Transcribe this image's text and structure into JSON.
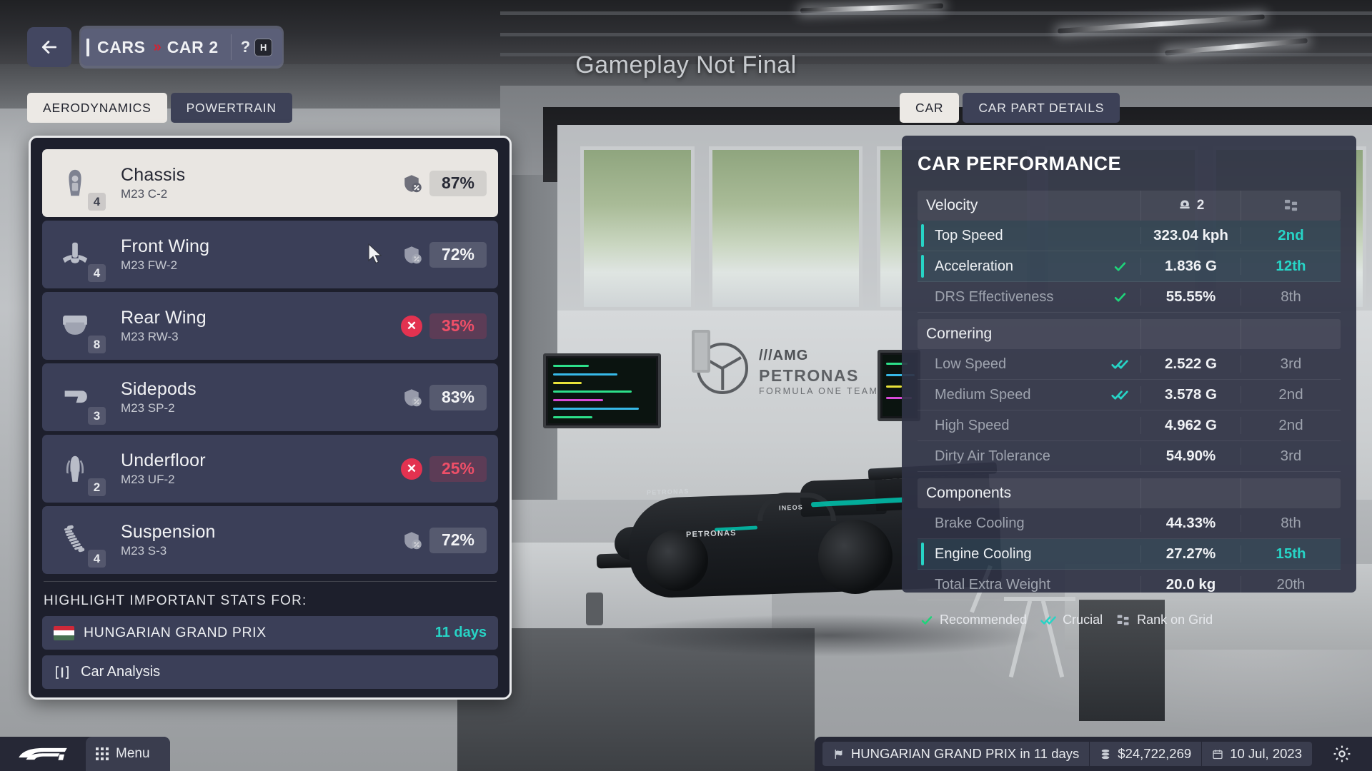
{
  "watermark": "Gameplay Not Final",
  "nav": {
    "back_icon": "arrow-left-icon",
    "breadcrumb_root": "CARS",
    "breadcrumb_sep": "»",
    "breadcrumb_current": "CAR 2",
    "help_glyph": "?",
    "help_key": "H"
  },
  "tabs_left": [
    {
      "label": "AERODYNAMICS",
      "active": true
    },
    {
      "label": "POWERTRAIN",
      "active": false
    }
  ],
  "tabs_right": [
    {
      "label": "CAR",
      "active": true
    },
    {
      "label": "CAR PART DETAILS",
      "active": false
    }
  ],
  "parts": [
    {
      "name": "Chassis",
      "model": "M23 C-2",
      "count": "4",
      "condition": "87%",
      "status": "ok",
      "icon": "chassis-icon",
      "selected": true
    },
    {
      "name": "Front Wing",
      "model": "M23 FW-2",
      "count": "4",
      "condition": "72%",
      "status": "ok",
      "icon": "front-wing-icon",
      "selected": false
    },
    {
      "name": "Rear Wing",
      "model": "M23 RW-3",
      "count": "8",
      "condition": "35%",
      "status": "bad",
      "icon": "rear-wing-icon",
      "selected": false
    },
    {
      "name": "Sidepods",
      "model": "M23 SP-2",
      "count": "3",
      "condition": "83%",
      "status": "ok",
      "icon": "sidepods-icon",
      "selected": false
    },
    {
      "name": "Underfloor",
      "model": "M23 UF-2",
      "count": "2",
      "condition": "25%",
      "status": "bad",
      "icon": "underfloor-icon",
      "selected": false
    },
    {
      "name": "Suspension",
      "model": "M23 S-3",
      "count": "4",
      "condition": "72%",
      "status": "ok",
      "icon": "suspension-icon",
      "selected": false
    }
  ],
  "highlight": {
    "label": "HIGHLIGHT IMPORTANT STATS FOR:",
    "race_name": "HUNGARIAN GRAND PRIX",
    "race_days": "11 days",
    "flag": [
      "#ce2939",
      "#ffffff",
      "#477050"
    ],
    "analysis_label": "Car Analysis"
  },
  "performance": {
    "title": "CAR PERFORMANCE",
    "driver_number": "2",
    "groups": [
      {
        "name": "Velocity",
        "show_header_icons": true,
        "rows": [
          {
            "name": "Top Speed",
            "mark": "",
            "value": "323.04 kph",
            "rank": "2nd",
            "highlight": true,
            "rank_teal": true
          },
          {
            "name": "Acceleration",
            "mark": "check",
            "value": "1.836 G",
            "rank": "12th",
            "highlight": true,
            "rank_teal": true
          },
          {
            "name": "DRS Effectiveness",
            "mark": "check",
            "value": "55.55%",
            "rank": "8th",
            "highlight": false,
            "rank_teal": false
          }
        ]
      },
      {
        "name": "Cornering",
        "show_header_icons": false,
        "rows": [
          {
            "name": "Low Speed",
            "mark": "dblcheck",
            "value": "2.522 G",
            "rank": "3rd",
            "highlight": false,
            "rank_teal": false
          },
          {
            "name": "Medium Speed",
            "mark": "dblcheck",
            "value": "3.578 G",
            "rank": "2nd",
            "highlight": false,
            "rank_teal": false
          },
          {
            "name": "High Speed",
            "mark": "",
            "value": "4.962 G",
            "rank": "2nd",
            "highlight": false,
            "rank_teal": false
          },
          {
            "name": "Dirty Air Tolerance",
            "mark": "",
            "value": "54.90%",
            "rank": "3rd",
            "highlight": false,
            "rank_teal": false
          }
        ]
      },
      {
        "name": "Components",
        "show_header_icons": false,
        "rows": [
          {
            "name": "Brake Cooling",
            "mark": "",
            "value": "44.33%",
            "rank": "8th",
            "highlight": false,
            "rank_teal": false
          },
          {
            "name": "Engine Cooling",
            "mark": "",
            "value": "27.27%",
            "rank": "15th",
            "highlight": true,
            "rank_teal": true
          },
          {
            "name": "Total Extra Weight",
            "mark": "",
            "value": "20.0 kg",
            "rank": "20th",
            "highlight": false,
            "rank_teal": false
          }
        ]
      }
    ],
    "legend": {
      "recommended": "Recommended",
      "crucial": "Crucial",
      "rank_on_grid": "Rank on Grid"
    }
  },
  "bottom_bar": {
    "menu_label": "Menu",
    "next_race": "HUNGARIAN GRAND PRIX in 11 days",
    "money": "$24,722,269",
    "date": "10 Jul, 2023"
  },
  "colors": {
    "teal": "#27d4c6",
    "red": "#e33250",
    "panel": "#2f3345",
    "selected": "#e9e6e2"
  }
}
